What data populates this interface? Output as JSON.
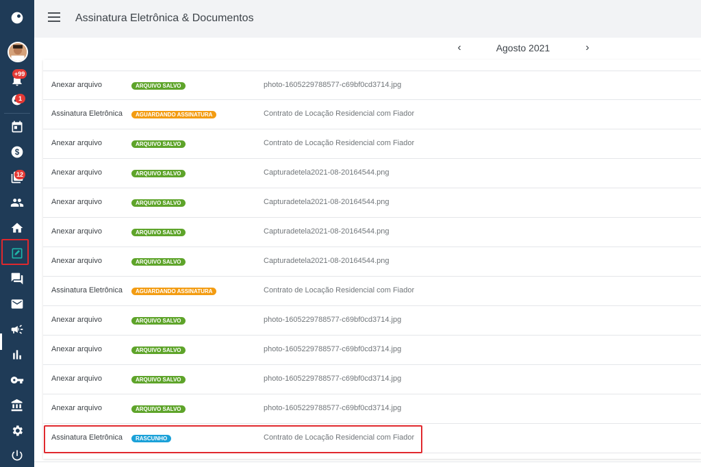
{
  "header": {
    "title": "Assinatura Eletrônica & Documentos"
  },
  "calendar": {
    "month": "Agosto 2021"
  },
  "sidebar": {
    "badges": {
      "notifications": "+99",
      "likes": "1",
      "contacts": "12"
    },
    "items": [
      {
        "icon": "logo-icon"
      },
      {
        "icon": "avatar"
      },
      {
        "icon": "bell-icon"
      },
      {
        "icon": "thumb-icon"
      },
      {
        "icon": "calendar-icon"
      },
      {
        "icon": "dollar-icon"
      },
      {
        "icon": "contacts-icon"
      },
      {
        "icon": "people-icon"
      },
      {
        "icon": "home-icon"
      },
      {
        "icon": "edit-icon"
      },
      {
        "icon": "chat-icon"
      },
      {
        "icon": "mail-icon"
      },
      {
        "icon": "megaphone-icon"
      },
      {
        "icon": "chart-icon"
      },
      {
        "icon": "key-icon"
      },
      {
        "icon": "bank-icon"
      },
      {
        "icon": "gear-icon"
      },
      {
        "icon": "power-icon"
      }
    ]
  },
  "rows": [
    {
      "type": "Anexar arquivo",
      "status": "ARQUIVO SALVO",
      "doc": "photo-1605229788577-c69bf0cd3714.jpg"
    },
    {
      "type": "Assinatura Eletrônica",
      "status": "AGUARDANDO ASSINATURA",
      "doc": "Contrato de Locação Residencial com Fiador"
    },
    {
      "type": "Anexar arquivo",
      "status": "ARQUIVO SALVO",
      "doc": "Contrato de Locação Residencial com Fiador"
    },
    {
      "type": "Anexar arquivo",
      "status": "ARQUIVO SALVO",
      "doc": "Capturadetela2021-08-20164544.png"
    },
    {
      "type": "Anexar arquivo",
      "status": "ARQUIVO SALVO",
      "doc": "Capturadetela2021-08-20164544.png"
    },
    {
      "type": "Anexar arquivo",
      "status": "ARQUIVO SALVO",
      "doc": "Capturadetela2021-08-20164544.png"
    },
    {
      "type": "Anexar arquivo",
      "status": "ARQUIVO SALVO",
      "doc": "Capturadetela2021-08-20164544.png"
    },
    {
      "type": "Assinatura Eletrônica",
      "status": "AGUARDANDO ASSINATURA",
      "doc": "Contrato de Locação Residencial com Fiador"
    },
    {
      "type": "Anexar arquivo",
      "status": "ARQUIVO SALVO",
      "doc": "photo-1605229788577-c69bf0cd3714.jpg"
    },
    {
      "type": "Anexar arquivo",
      "status": "ARQUIVO SALVO",
      "doc": "photo-1605229788577-c69bf0cd3714.jpg"
    },
    {
      "type": "Anexar arquivo",
      "status": "ARQUIVO SALVO",
      "doc": "photo-1605229788577-c69bf0cd3714.jpg"
    },
    {
      "type": "Anexar arquivo",
      "status": "ARQUIVO SALVO",
      "doc": "photo-1605229788577-c69bf0cd3714.jpg"
    },
    {
      "type": "Assinatura Eletrônica",
      "status": "RASCUNHO",
      "doc": "Contrato de Locação Residencial com Fiador"
    }
  ],
  "colors": {
    "sidebar": "#1f3b57",
    "saved": "#5ea42a",
    "awaiting": "#f39c12",
    "draft": "#1ba1d8",
    "highlight": "#e0282d"
  }
}
